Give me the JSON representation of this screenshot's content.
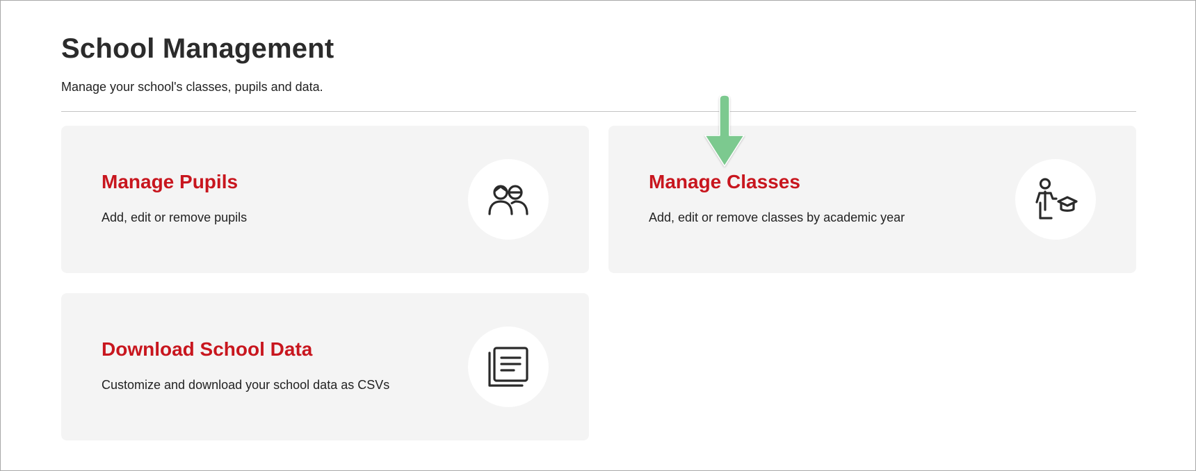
{
  "header": {
    "title": "School Management",
    "subtitle": "Manage your school's classes, pupils and data."
  },
  "cards": [
    {
      "title": "Manage Pupils",
      "description": "Add, edit or remove pupils",
      "icon": "pupils-icon"
    },
    {
      "title": "Manage Classes",
      "description": "Add, edit or remove classes by academic year",
      "icon": "teacher-graduation-icon"
    },
    {
      "title": "Download School Data",
      "description": "Customize and download your school data as CSVs",
      "icon": "documents-icon"
    }
  ],
  "annotation": {
    "icon": "down-arrow-icon",
    "color": "#7cc98f"
  },
  "colors": {
    "accent": "#c8161e",
    "card_background": "#f4f4f4",
    "title_text": "#2b2b2b",
    "annotation_arrow": "#7cc98f"
  }
}
